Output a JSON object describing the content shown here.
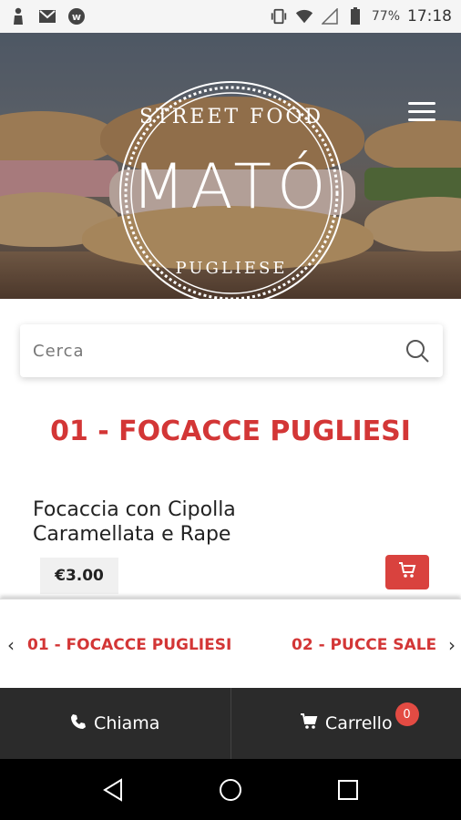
{
  "status_bar": {
    "battery_percent": "77%",
    "time": "17:18",
    "icons": [
      "person-icon",
      "gmail-icon",
      "app-w-icon",
      "vibrate-icon",
      "wifi-icon",
      "signal-icon",
      "battery-icon"
    ]
  },
  "hero": {
    "logo_top": "STREET FOOD",
    "logo_main": "MATÓ",
    "logo_bottom": "PUGLIESE"
  },
  "search": {
    "placeholder": "Cerca"
  },
  "section": {
    "title": "01 - FOCACCE PUGLIESI"
  },
  "product": {
    "name_line1": "Focaccia con Cipolla",
    "name_line2": "Caramellata e Rape",
    "price": "€3.00"
  },
  "category_nav": {
    "prev_arrow": "‹",
    "next_arrow": "›",
    "items": [
      "01 - FOCACCE PUGLIESI",
      "02 - PUCCE SALE"
    ]
  },
  "bottom_bar": {
    "call_label": "Chiama",
    "cart_label": "Carrello",
    "cart_count": "0"
  },
  "colors": {
    "accent": "#d33636",
    "cart_button": "#d9423e",
    "bottom_bar": "#2b2b2b"
  }
}
